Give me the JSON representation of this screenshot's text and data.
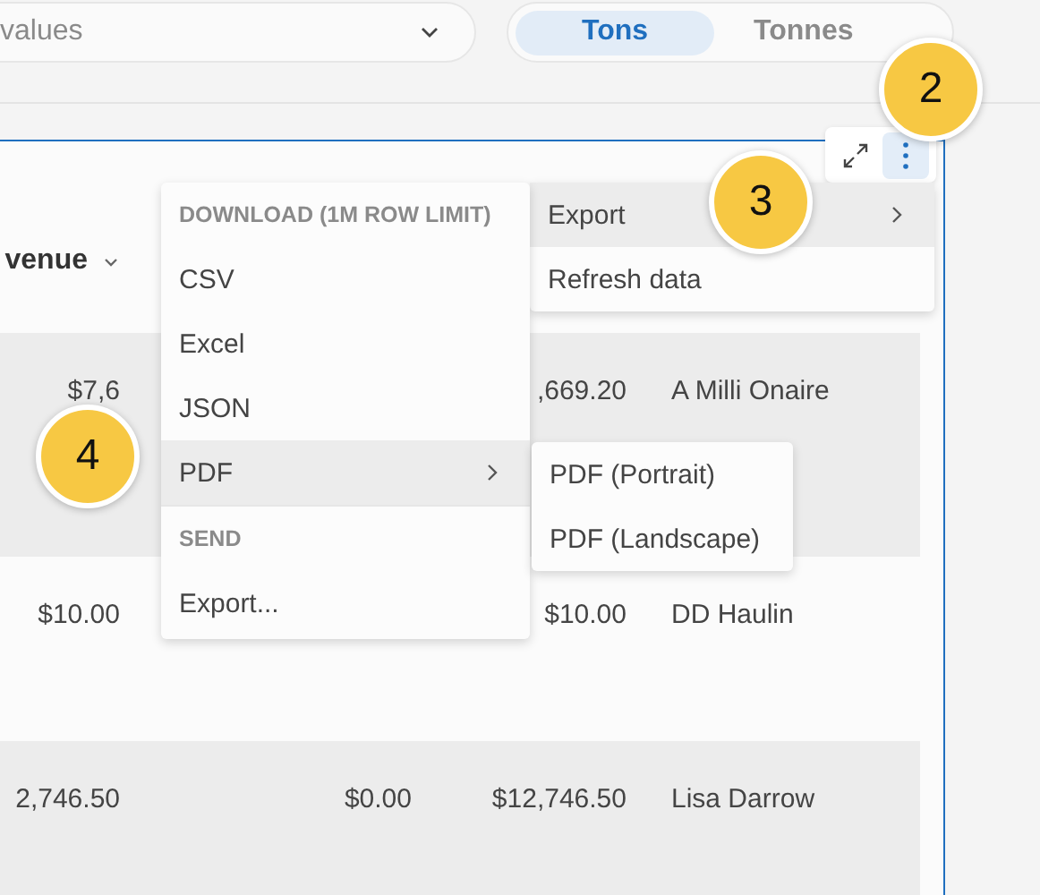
{
  "filter": {
    "value": "values"
  },
  "unit_toggle": [
    {
      "label": "Tons",
      "selected": true
    },
    {
      "label": "Tonnes",
      "selected": false
    }
  ],
  "card_toolbar": {
    "more_selected": true
  },
  "table": {
    "columns": [
      {
        "label": "venue"
      }
    ],
    "rows": [
      {
        "col1": "$7,6",
        "col3": ",669.20",
        "col4": "A Milli Onaire",
        "shaded": true
      },
      {
        "col1": "$10.00",
        "col3": "$10.00",
        "col4": "DD Haulin",
        "shaded": false
      },
      {
        "col1": "2,746.50",
        "col2": "$0.00",
        "col3": "$12,746.50",
        "col4": "Lisa Darrow",
        "shaded": true
      }
    ]
  },
  "more_menu": [
    {
      "label": "Export",
      "has_submenu": true,
      "highlighted": true
    },
    {
      "label": "Refresh data",
      "has_submenu": false,
      "highlighted": false
    }
  ],
  "export_menu": [
    {
      "kind": "header",
      "label": "DOWNLOAD (1M ROW LIMIT)"
    },
    {
      "kind": "item",
      "label": "CSV",
      "has_submenu": false,
      "highlighted": false
    },
    {
      "kind": "item",
      "label": "Excel",
      "has_submenu": false,
      "highlighted": false
    },
    {
      "kind": "item",
      "label": "JSON",
      "has_submenu": false,
      "highlighted": false
    },
    {
      "kind": "item",
      "label": "PDF",
      "has_submenu": true,
      "highlighted": true
    },
    {
      "kind": "divider"
    },
    {
      "kind": "header",
      "label": "SEND"
    },
    {
      "kind": "item",
      "label": "Export...",
      "has_submenu": false,
      "highlighted": false
    }
  ],
  "pdf_menu": [
    {
      "label": "PDF (Portrait)",
      "highlighted": false
    },
    {
      "label": "PDF (Landscape)",
      "highlighted": false
    }
  ],
  "callouts": [
    {
      "number": "2"
    },
    {
      "number": "3"
    },
    {
      "number": "4"
    }
  ]
}
